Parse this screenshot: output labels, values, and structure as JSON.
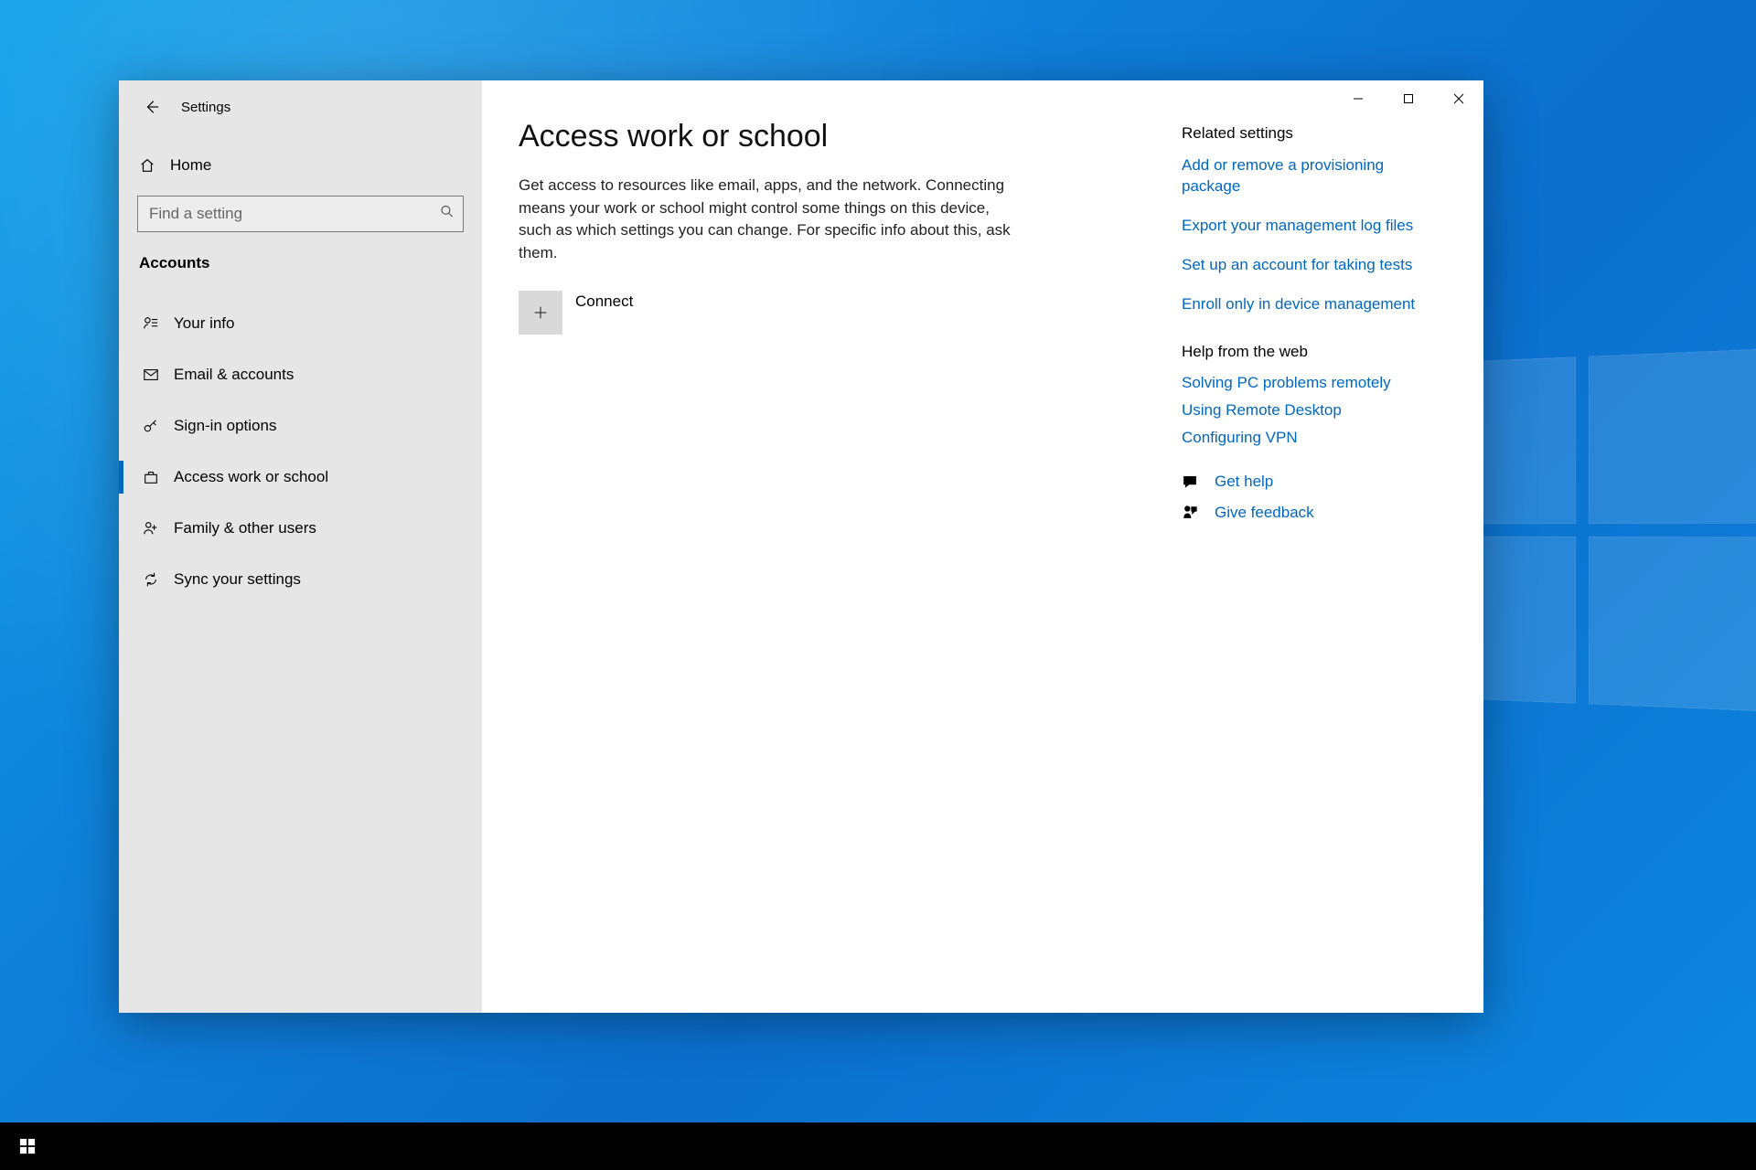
{
  "window": {
    "app_title": "Settings",
    "home": "Home",
    "search_placeholder": "Find a setting",
    "category": "Accounts",
    "nav": [
      {
        "label": "Your info"
      },
      {
        "label": "Email & accounts"
      },
      {
        "label": "Sign-in options"
      },
      {
        "label": "Access work or school"
      },
      {
        "label": "Family & other users"
      },
      {
        "label": "Sync your settings"
      }
    ]
  },
  "main": {
    "title": "Access work or school",
    "description": "Get access to resources like email, apps, and the network. Connecting means your work or school might control some things on this device, such as which settings you can change. For specific info about this, ask them.",
    "connect_label": "Connect"
  },
  "rail": {
    "related_heading": "Related settings",
    "related_links": [
      "Add or remove a provisioning package",
      "Export your management log files",
      "Set up an account for taking tests",
      "Enroll only in device management"
    ],
    "help_heading": "Help from the web",
    "help_links": [
      "Solving PC problems remotely",
      "Using Remote Desktop",
      "Configuring VPN"
    ],
    "get_help": "Get help",
    "give_feedback": "Give feedback"
  }
}
